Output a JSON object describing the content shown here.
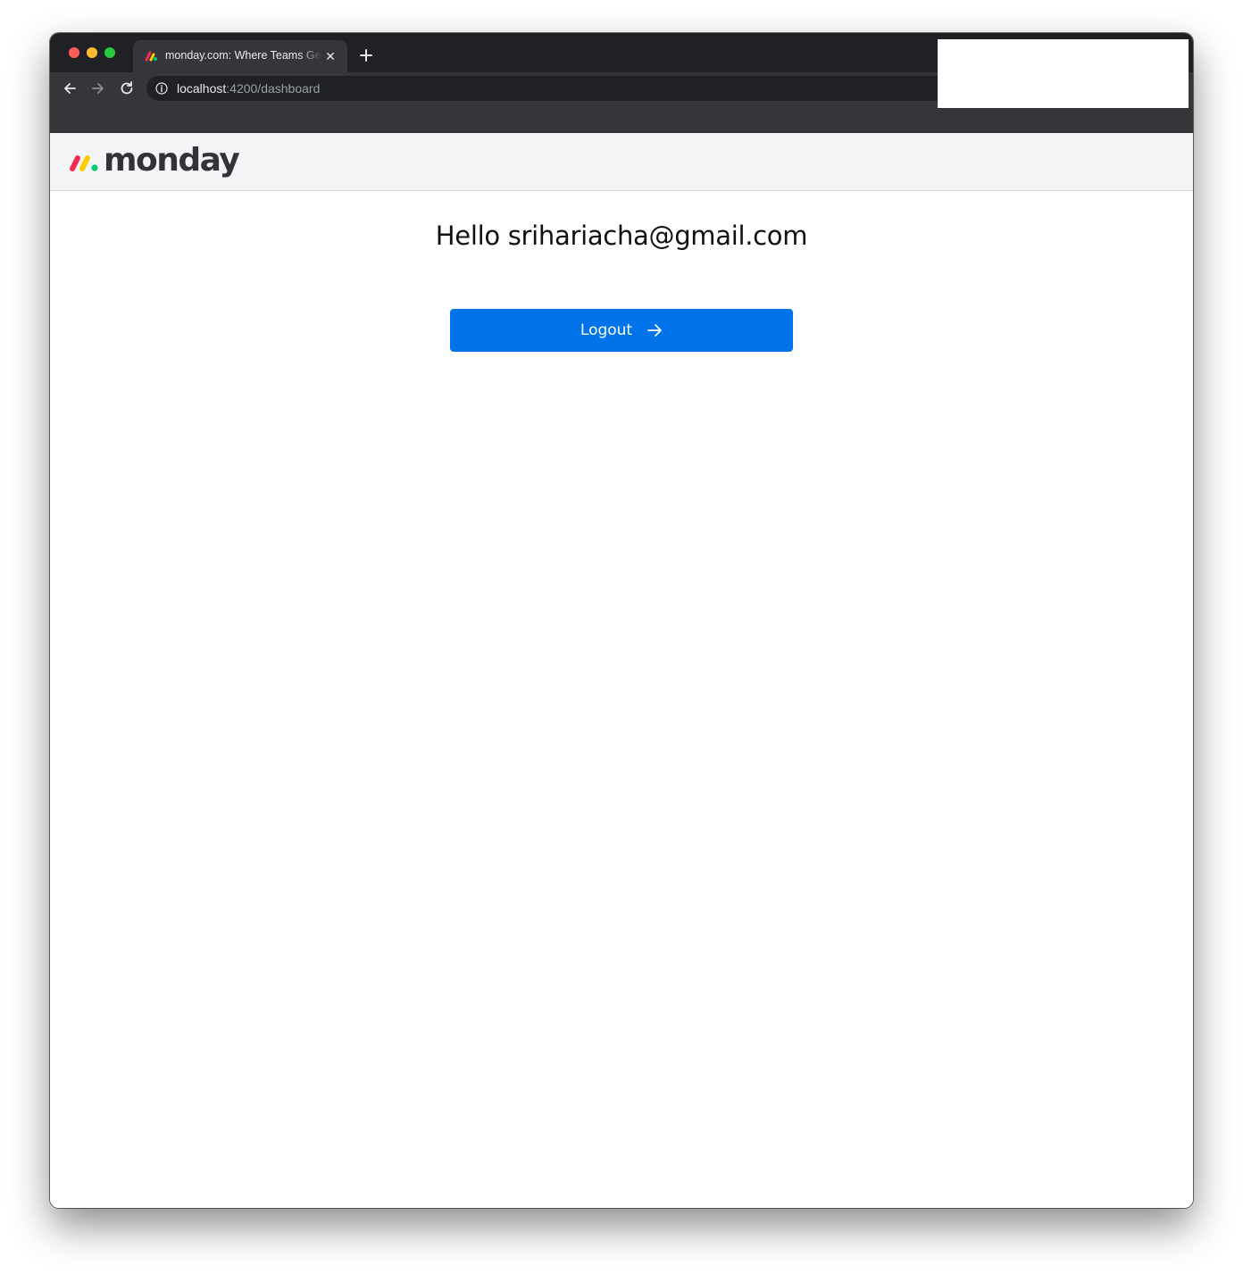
{
  "browser": {
    "tab": {
      "title": "monday.com: Where Teams Get Work Done",
      "close_glyph": "✕"
    },
    "address_bar": {
      "host": "localhost",
      "path": ":4200/dashboard"
    },
    "icons": [
      "monday-favicon-icon",
      "close-icon",
      "plus-icon",
      "back-arrow-icon",
      "forward-arrow-icon",
      "reload-icon",
      "info-icon"
    ]
  },
  "app": {
    "brand": {
      "name": "monday",
      "colors": [
        "#f62b54",
        "#ffcc00",
        "#00ca72"
      ]
    },
    "greeting": "Hello srihariacha@gmail.com",
    "logout_button": {
      "label": "Logout",
      "icon": "arrow-right-icon",
      "color": "#0073ea"
    }
  }
}
